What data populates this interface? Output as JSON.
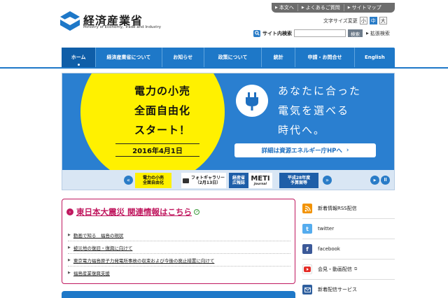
{
  "header": {
    "logo_ja": "経済産業省",
    "logo_en": "Ministry of Economy, Trade and Industry"
  },
  "util_links": [
    "本文へ",
    "よくあるご質問",
    "サイトマップ"
  ],
  "font_size": {
    "label": "文字サイズ変更",
    "options": [
      "小",
      "中",
      "大"
    ],
    "selected": "中"
  },
  "search": {
    "label": "サイト内検索",
    "value": "",
    "button": "検索",
    "advanced": "拡張検索"
  },
  "nav": [
    "ホーム",
    "経済産業省について",
    "お知らせ",
    "政策について",
    "統計",
    "申請・お問合せ",
    "English"
  ],
  "hero": {
    "left_lines": [
      "電力の小売",
      "全面自由化",
      "スタート！"
    ],
    "date": "2016年4月1日",
    "right_lines": [
      "あなたに合った",
      "電気を選べる",
      "時代へ。"
    ],
    "link": "詳細は資源エネルギー庁HPへ"
  },
  "carousel": {
    "items": [
      {
        "line1": "電力の小売",
        "line2": "全面自由化"
      },
      {
        "line1": "フォトギャラリー",
        "line2": "（2月13日）"
      },
      {
        "line1": "経産省",
        "line2": "広報誌"
      },
      {
        "line1": "METI",
        "line2": "Journal"
      },
      {
        "line1": "平成28年度",
        "line2": "予算案等"
      }
    ]
  },
  "quake": {
    "title": "東日本大震災 関連情報はこちら",
    "items": [
      "動画で知る　福島の現状",
      "被災地の復旧・復興に向けて",
      "東京電力福島原子力発電所事故の収束および今後の廃止措置に向けて",
      "福島産業復興支援"
    ]
  },
  "right_links": [
    {
      "label": "新着情報RSS配信",
      "icon": "rss-icon",
      "color": "#f29200",
      "external": false
    },
    {
      "label": "twitter",
      "icon": "twitter-icon",
      "color": "#55acee",
      "external": false
    },
    {
      "label": "facebook",
      "icon": "facebook-icon",
      "color": "#3b5998",
      "external": false
    },
    {
      "label": "会見・動画配信",
      "icon": "youtube-icon",
      "color": "#e52d27",
      "external": true
    },
    {
      "label": "新着配信サービス",
      "icon": "mail-icon",
      "color": "#2f5f9e",
      "external": false
    }
  ],
  "colors": {
    "brand_blue": "#1e78c8",
    "accent_yellow": "#fff100",
    "quake_red": "#c0185f"
  }
}
